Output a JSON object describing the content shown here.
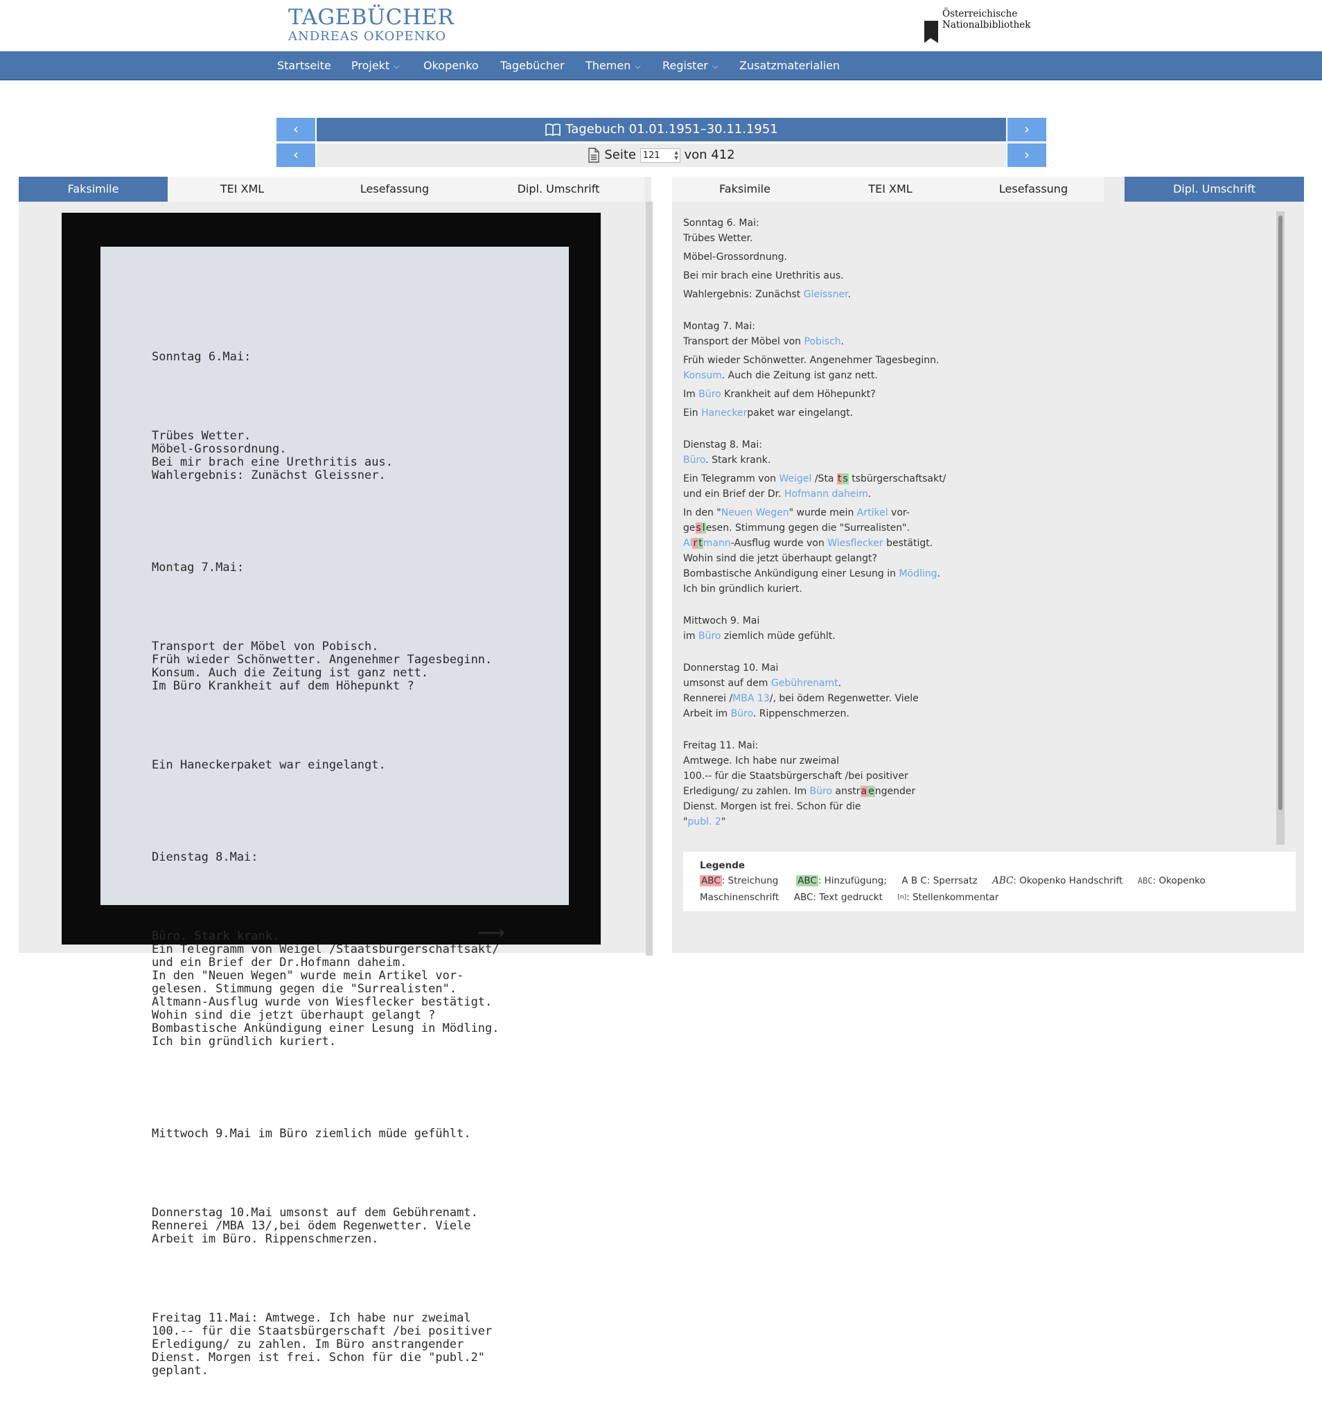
{
  "header": {
    "logo_line1": "TAGEBÜCHER",
    "logo_line2": "ANDREAS OKOPENKO",
    "partner_line1": "Österreichische",
    "partner_line2": "Nationalbibliothek"
  },
  "nav": {
    "items": [
      {
        "label": "Startseite",
        "dropdown": false
      },
      {
        "label": "Projekt",
        "dropdown": true
      },
      {
        "label": "Okopenko",
        "dropdown": false
      },
      {
        "label": "Tagebücher",
        "dropdown": false
      },
      {
        "label": "Themen",
        "dropdown": true
      },
      {
        "label": "Register",
        "dropdown": true
      },
      {
        "label": "Zusatzmaterialien",
        "dropdown": false
      }
    ]
  },
  "pager": {
    "diary_title": "Tagebuch 01.01.1951–30.11.1951",
    "page_label": "Seite",
    "page_value": "121",
    "page_of": "von 412",
    "prev_symbol": "‹",
    "next_symbol": "›"
  },
  "left_panel": {
    "tabs": [
      "Faksimile",
      "TEI XML",
      "Lesefassung",
      "Dipl. Umschrift"
    ],
    "active_tab": "Faksimile",
    "typewriter": [
      "Sonntag 6.Mai:",
      "",
      "Trübes Wetter.\nMöbel-Grossordnung.\nBei mir brach eine Urethritis aus.\nWahlergebnis: Zunächst Gleissner.",
      "",
      "Montag 7.Mai:",
      "",
      "Transport der Möbel von Pobisch.\nFrüh wieder Schönwetter. Angenehmer Tagesbeginn.\nKonsum. Auch die Zeitung ist ganz nett.\nIm Büro Krankheit auf dem Höhepunkt ?",
      "",
      "Ein Haneckerpaket war eingelangt.",
      "",
      "Dienstag 8.Mai:",
      "",
      "Büro. Stark krank.\nEin Telegramm von Weigel /Staatsbürgerschaftsakt/\nund ein Brief der Dr.Hofmann daheim.\nIn den \"Neuen Wegen\" wurde mein Artikel vor-\ngelesen. Stimmung gegen die \"Surrealisten\".\nAltmann-Ausflug wurde von Wiesflecker bestätigt.\nWohin sind die jetzt überhaupt gelangt ?\nBombastische Ankündigung einer Lesung in Mödling.\nIch bin gründlich kuriert.",
      "",
      "Mittwoch 9.Mai im Büro ziemlich müde gefühlt.",
      "",
      "Donnerstag 10.Mai umsonst auf dem Gebührenamt.\nRennerei /MBA 13/,bei ödem Regenwetter. Viele\nArbeit im Büro. Rippenschmerzen.",
      "",
      "Freitag 11.Mai: Amtwege. Ich habe nur zweimal\n100.-- für die Staatsbürgerschaft /bei positiver\nErledigung/ zu zahlen. Im Büro anstrangender\nDienst. Morgen ist frei. Schon für die \"publ.2\"\ngeplant."
    ],
    "arrow": "⟶"
  },
  "right_panel": {
    "tabs": [
      "Faksimile",
      "TEI XML",
      "Lesefassung",
      "Dipl. Umschrift"
    ],
    "active_tab": "Dipl. Umschrift",
    "t": {
      "d1": "Sonntag 6. Mai:",
      "l1": "Trübes Wetter.",
      "l2": "Möbel-Grossordnung.",
      "l3": "Bei mir brach eine Urethritis aus.",
      "l4a": "Wahlergebnis: Zunächst ",
      "l4b": "Gleissner",
      "l4c": ".",
      "d2": "Montag 7. Mai:",
      "l5a": "Transport der Möbel von ",
      "l5b": "Pobisch",
      "l5c": ".",
      "l6": "Früh wieder Schönwetter. Angenehmer Tagesbeginn.",
      "l7a": "Konsum",
      "l7b": ". Auch die Zeitung ist ganz nett.",
      "l8a": "Im ",
      "l8b": "Büro",
      "l8c": " Krankheit auf dem Höhepunkt?",
      "l9a": "Ein ",
      "l9b": "Hanecker",
      "l9c": "paket war eingelangt.",
      "d3": "Dienstag 8. Mai:",
      "l10a": "Büro",
      "l10b": ". Stark krank.",
      "l11a": "Ein Telegramm von ",
      "l11b": "Weigel",
      "l11c": " /Sta",
      "l11del": "t",
      "l11add": "s",
      "l11d": " tsbürgerschaftsakt/",
      "l12a": "und ein Brief der Dr. ",
      "l12b": "Hofmann daheim",
      "l12c": ".",
      "l13a": "In den \"",
      "l13b": "Neuen Wegen",
      "l13c": "\" wurde mein ",
      "l13d": "Artikel",
      "l13e": " vor-",
      "l14a": "ge",
      "l14del": "s",
      "l14add": "l",
      "l14b": "esen. Stimmung gegen die \"Surrealisten\".",
      "l15a": "Al",
      "l15del": "r",
      "l15add": "t",
      "l15b": "mann",
      "l15c": "-Ausflug wurde von ",
      "l15d": "Wiesflecker",
      "l15e": " bestätigt.",
      "l16": "Wohin sind die jetzt überhaupt gelangt?",
      "l17a": "Bombastische Ankündigung einer Lesung in ",
      "l17b": "Mödling",
      "l17c": ".",
      "l18": "Ich bin gründlich kuriert.",
      "d4": "Mittwoch 9. Mai",
      "l19a": "im ",
      "l19b": "Büro",
      "l19c": " ziemlich müde gefühlt.",
      "d5": "Donnerstag 10. Mai",
      "l20a": "umsonst auf dem ",
      "l20b": "Gebührenamt",
      "l20c": ".",
      "l21a": "Rennerei /",
      "l21b": "MBA 13",
      "l21c": "/, bei ödem Regenwetter. Viele",
      "l22a": "Arbeit im ",
      "l22b": "Büro",
      "l22c": ". Rippenschmerzen.",
      "d6": "Freitag 11. Mai:",
      "l23": "Amtwege. Ich habe nur zweimal",
      "l24": "100.-- für die Staatsbürgerschaft /bei positiver",
      "l25a": "Erledigung/ zu zahlen. Im ",
      "l25b": "Büro",
      "l25c": " anstr",
      "l25del": "a",
      "l25add": "e",
      "l25d": "ngender",
      "l26": "Dienst. Morgen ist frei. Schon für die",
      "l27a": "\"",
      "l27b": "publ. 2",
      "l27c": "\""
    },
    "legend": {
      "title": "Legende",
      "strike_sample": "ABC",
      "strike_label": ": Streichung",
      "add_sample": "ABC",
      "add_label": ": Hinzufügung;",
      "spaced_sample": "A B C",
      "spaced_label": ": Sperrsatz",
      "hand_sample": "ABC",
      "hand_label": ": Okopenko Handschrift",
      "type_sample": "ABC",
      "type_label": ": Okopenko",
      "type_label2": "Maschinenschrift",
      "print_sample": "ABC",
      "print_label": ": Text gedruckt",
      "comment_sample": "[n]",
      "comment_label": ": Stellenkommentar"
    }
  },
  "colors": {
    "brand": "#4b75ad",
    "button": "#6aa3e8",
    "link": "#6aa3e8",
    "deletion": "#f2a8a8",
    "addition": "#a9d8a9"
  }
}
